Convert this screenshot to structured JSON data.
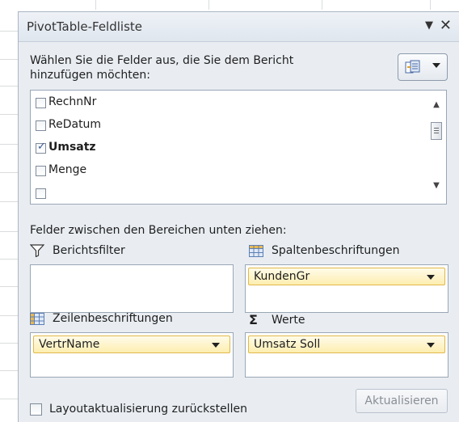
{
  "pane": {
    "title": "PivotTable-Feldliste",
    "menu_glyph": "▼",
    "close_glyph": "✕"
  },
  "instructions": "Wählen Sie die Felder aus, die Sie dem Bericht hinzufügen möchten:",
  "fields": [
    {
      "label": "RechnNr",
      "checked": false
    },
    {
      "label": "ReDatum",
      "checked": false
    },
    {
      "label": "Umsatz",
      "checked": true
    },
    {
      "label": "Menge",
      "checked": false
    }
  ],
  "drag_hint": "Felder zwischen den Bereichen unten ziehen:",
  "areas": {
    "filter": {
      "label": "Berichtsfilter",
      "icon": "filter-icon"
    },
    "columns": {
      "label": "Spaltenbeschriftungen",
      "icon": "table-grid-icon",
      "field": "KundenGr"
    },
    "rows": {
      "label": "Zeilenbeschriftungen",
      "icon": "table-grid-icon",
      "field": "VertrName"
    },
    "values": {
      "label": "Werte",
      "icon": "sigma-icon",
      "symbol": "Σ",
      "field": "Umsatz Soll"
    }
  },
  "footer": {
    "defer_label": "Layoutaktualisierung zurückstellen",
    "update_label": "Aktualisieren"
  },
  "colors": {
    "pane_bg": "#e9edf2",
    "chip_border": "#e2b84a",
    "chip_bg": "#fdeeb0"
  }
}
